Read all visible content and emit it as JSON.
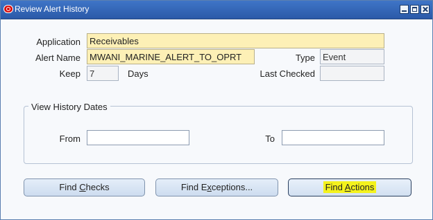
{
  "window": {
    "title": "Review Alert History"
  },
  "form": {
    "application_label": "Application",
    "application_value": "Receivables",
    "alert_name_label": "Alert Name",
    "alert_name_value": "MWANI_MARINE_ALERT_TO_OPRT",
    "type_label": "Type",
    "type_value": "Event",
    "keep_label": "Keep",
    "keep_value": "7",
    "days_label": "Days",
    "last_checked_label": "Last Checked",
    "last_checked_value": ""
  },
  "history_dates": {
    "title": "View History Dates",
    "from_label": "From",
    "from_value": "",
    "to_label": "To",
    "to_value": ""
  },
  "buttons": {
    "find_checks_pre": "Find ",
    "find_checks_mnemonic": "C",
    "find_checks_post": "hecks",
    "find_exceptions_pre": "Find E",
    "find_exceptions_mnemonic": "x",
    "find_exceptions_post": "ceptions...",
    "find_actions_pre": "Find ",
    "find_actions_mnemonic": "A",
    "find_actions_post": "ctions",
    "highlight_color": "#f4f21d"
  }
}
